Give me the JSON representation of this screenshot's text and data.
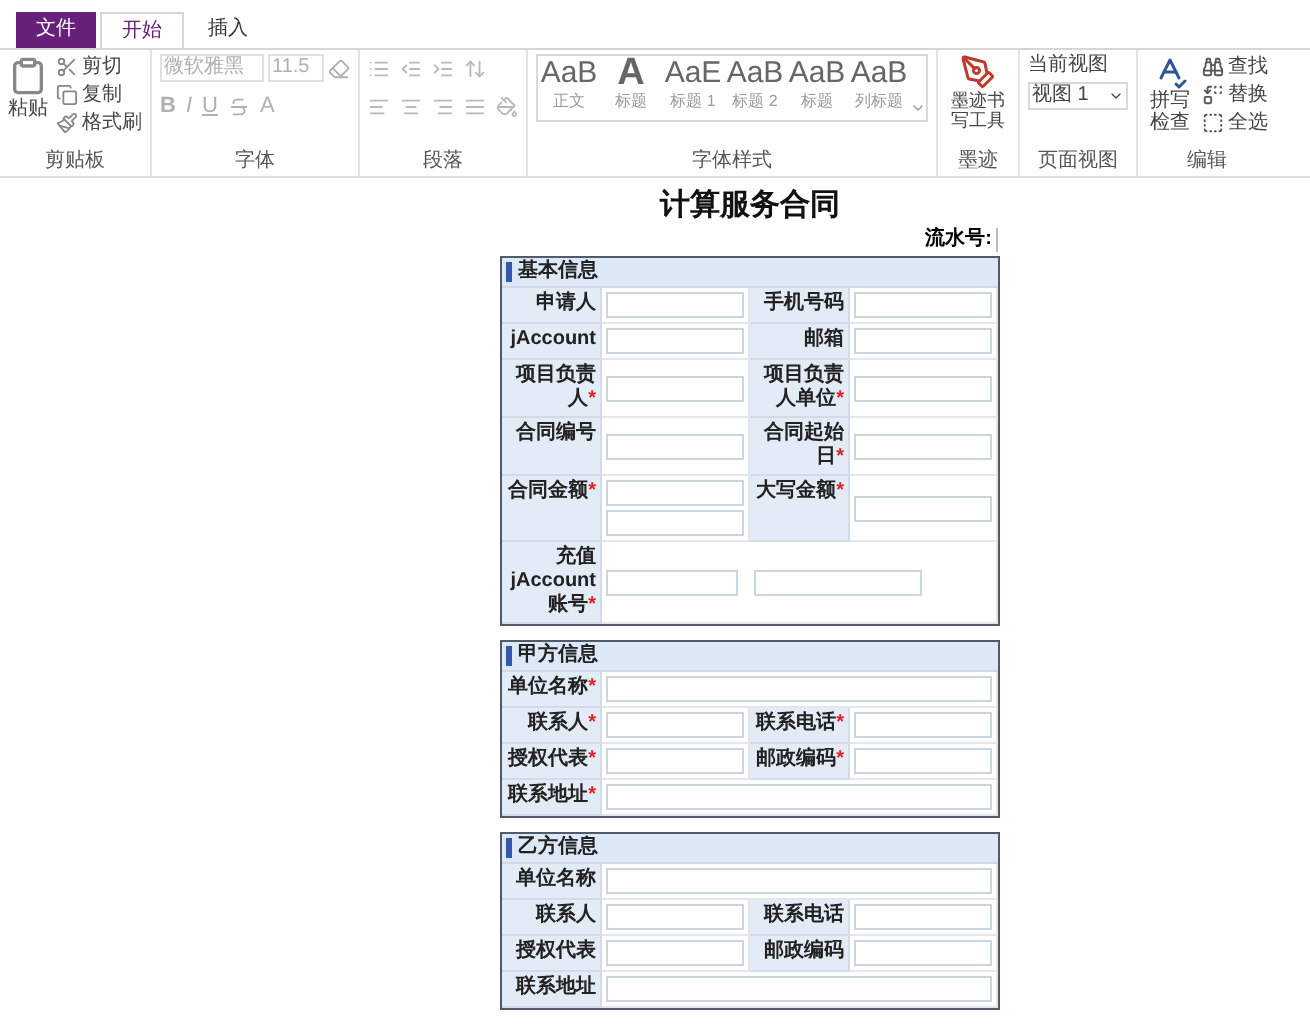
{
  "ribbon": {
    "tabs": [
      {
        "label": "文件",
        "kind": "file",
        "selected": false
      },
      {
        "label": "开始",
        "kind": "tab",
        "selected": true
      },
      {
        "label": "插入",
        "kind": "tab",
        "selected": false
      }
    ],
    "clipboard": {
      "paste": "粘贴",
      "items": [
        "剪切",
        "复制",
        "格式刷"
      ],
      "caption": "剪贴板"
    },
    "font": {
      "font_name": "微软雅黑",
      "size": "11.5",
      "format_buttons": [
        "B",
        "I",
        "U",
        "A"
      ],
      "caption": "字体",
      "disabled": true
    },
    "paragraph": {
      "caption": "段落",
      "disabled": true
    },
    "styles": {
      "items": [
        {
          "sample": "AaB",
          "name": "正文"
        },
        {
          "sample": "A",
          "name": "标题"
        },
        {
          "sample": "AaE",
          "name": "标题 1"
        },
        {
          "sample": "AaB",
          "name": "标题 2"
        },
        {
          "sample": "AaB",
          "name": "标题"
        },
        {
          "sample": "AaB",
          "name": "列标题"
        }
      ],
      "caption": "字体样式"
    },
    "ink": {
      "label": "墨迹书写工具",
      "caption": "墨迹"
    },
    "view": {
      "label": "当前视图",
      "value": "视图 1",
      "caption": "页面视图"
    },
    "editing": {
      "spell": "拼写检查",
      "items": [
        "查找",
        "替换",
        "全选"
      ],
      "caption": "编辑"
    }
  },
  "document": {
    "title": "计算服务合同",
    "serial_label": "流水号:",
    "required_mark": "*",
    "sections": [
      {
        "title": "基本信息",
        "rows": [
          [
            {
              "label": "申请人",
              "required": false,
              "kind": "text"
            },
            {
              "label": "手机号码",
              "required": false,
              "kind": "text"
            }
          ],
          [
            {
              "label": "jAccount",
              "required": false,
              "kind": "text"
            },
            {
              "label": "邮箱",
              "required": false,
              "kind": "text"
            }
          ],
          [
            {
              "label": "项目负责人",
              "required": true,
              "kind": "text"
            },
            {
              "label": "项目负责人单位",
              "required": true,
              "kind": "text"
            }
          ],
          [
            {
              "label": "合同编号",
              "required": false,
              "kind": "text"
            },
            {
              "label": "合同起始日",
              "required": true,
              "kind": "text"
            }
          ],
          [
            {
              "label": "合同金额",
              "required": true,
              "kind": "stacked"
            },
            {
              "label": "大写金额",
              "required": true,
              "kind": "text"
            }
          ],
          [
            {
              "label": "充值jAccount账号",
              "required": true,
              "kind": "split"
            }
          ]
        ]
      },
      {
        "title": "甲方信息",
        "rows": [
          [
            {
              "label": "单位名称",
              "required": true,
              "kind": "text"
            }
          ],
          [
            {
              "label": "联系人",
              "required": true,
              "kind": "text"
            },
            {
              "label": "联系电话",
              "required": true,
              "kind": "text"
            }
          ],
          [
            {
              "label": "授权代表",
              "required": true,
              "kind": "text"
            },
            {
              "label": "邮政编码",
              "required": true,
              "kind": "text"
            }
          ],
          [
            {
              "label": "联系地址",
              "required": true,
              "kind": "text"
            }
          ]
        ]
      },
      {
        "title": "乙方信息",
        "rows": [
          [
            {
              "label": "单位名称",
              "required": false,
              "kind": "text"
            }
          ],
          [
            {
              "label": "联系人",
              "required": false,
              "kind": "text"
            },
            {
              "label": "联系电话",
              "required": false,
              "kind": "text"
            }
          ],
          [
            {
              "label": "授权代表",
              "required": false,
              "kind": "text"
            },
            {
              "label": "邮政编码",
              "required": false,
              "kind": "text"
            }
          ],
          [
            {
              "label": "联系地址",
              "required": false,
              "kind": "text"
            }
          ]
        ]
      }
    ]
  }
}
